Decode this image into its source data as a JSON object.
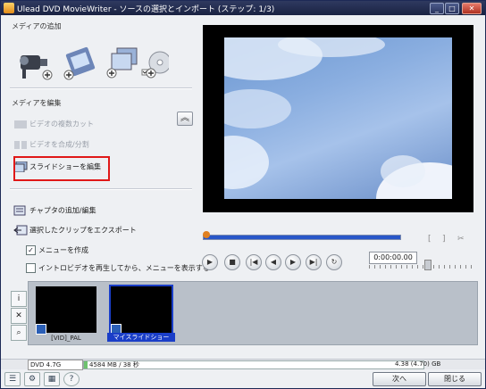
{
  "window": {
    "title": "Ulead DVD MovieWriter - ソースの選択とインポート (ステップ: 1/3)"
  },
  "media_add": {
    "title": "メディアの追加",
    "icons": [
      "video-camera-icon",
      "film-add-icon",
      "slideshow-add-icon",
      "disc-add-icon"
    ]
  },
  "media_edit": {
    "title": "メディアを編集",
    "tasks": [
      {
        "label": "ビデオの複数カット",
        "enabled": false
      },
      {
        "label": "ビデオを合成/分割",
        "enabled": false
      },
      {
        "label": "スライドショーを編集",
        "enabled": true,
        "highlighted": true
      }
    ]
  },
  "chapters": {
    "add_label": "チャプタの追加/編集",
    "export_label": "選択したクリップをエクスポート"
  },
  "options": {
    "create_menu": {
      "label": "メニューを作成",
      "checked": true
    },
    "intro_video": {
      "label": "イントロビデオを再生してから、メニューを表示する",
      "checked": false
    }
  },
  "player": {
    "timecode": "0:00:00.00",
    "progress": 0.0
  },
  "clips": [
    {
      "name": "[VID]_PAL",
      "selected": false
    },
    {
      "name": "マイスライドショー",
      "selected": true
    }
  ],
  "status": {
    "disc": "DVD 4.7G",
    "used": "4584 MB / 38 秒",
    "capacity": "4.38 (4.70) GB",
    "fill_fraction": 0.01
  },
  "buttons": {
    "next": "次へ",
    "close": "閉じる"
  }
}
